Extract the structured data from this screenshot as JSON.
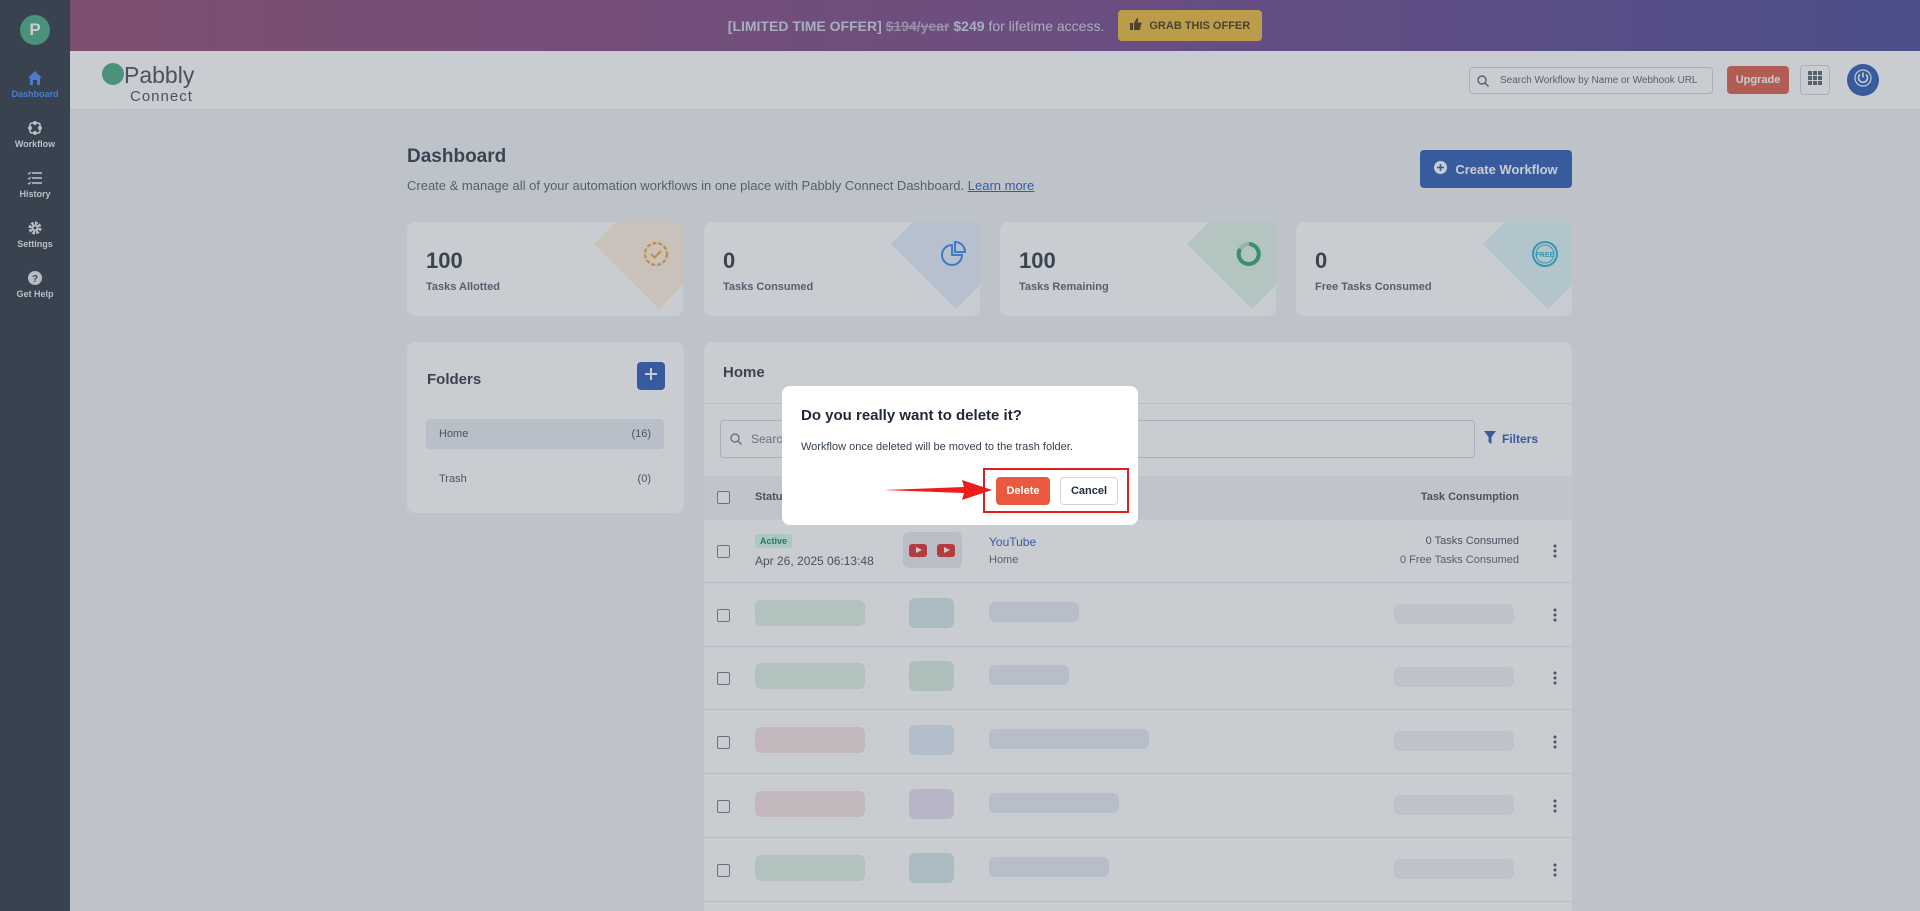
{
  "promo": {
    "prefix": "[LIMITED TIME OFFER]",
    "old_price": "$194/year",
    "new_price": "$249",
    "suffix": "for lifetime access.",
    "button": "GRAB THIS OFFER"
  },
  "sidebar": {
    "items": [
      {
        "label": "Dashboard",
        "icon": "home-icon"
      },
      {
        "label": "Workflow",
        "icon": "workflow-icon"
      },
      {
        "label": "History",
        "icon": "history-icon"
      },
      {
        "label": "Settings",
        "icon": "gear-icon"
      },
      {
        "label": "Get Help",
        "icon": "help-icon"
      }
    ]
  },
  "header": {
    "brand_name": "Pabbly",
    "brand_sub": "Connect",
    "search_placeholder": "Search Workflow by Name or Webhook URL",
    "upgrade": "Upgrade"
  },
  "page": {
    "title": "Dashboard",
    "subtitle": "Create & manage all of your automation workflows in one place with Pabbly Connect Dashboard.",
    "learn_more": "Learn more",
    "create_button": "Create Workflow"
  },
  "stats": [
    {
      "value": "100",
      "label": "Tasks Allotted",
      "icon": "badge-check-icon",
      "color": "#f0a030"
    },
    {
      "value": "0",
      "label": "Tasks Consumed",
      "icon": "pie-chart-icon",
      "color": "#2b7de9"
    },
    {
      "value": "100",
      "label": "Tasks Remaining",
      "icon": "progress-ring-icon",
      "color": "#22a35a"
    },
    {
      "value": "0",
      "label": "Free Tasks Consumed",
      "icon": "free-badge-icon",
      "color": "#1fa9c9"
    }
  ],
  "folders": {
    "title": "Folders",
    "items": [
      {
        "name": "Home",
        "count": "(16)"
      },
      {
        "name": "Trash",
        "count": "(0)"
      }
    ]
  },
  "panel": {
    "title": "Home",
    "search_placeholder": "Search",
    "filters": "Filters",
    "columns": {
      "status": "Status",
      "task": "Task Consumption"
    },
    "rows": [
      {
        "status": "Active",
        "date": "Apr 26, 2025 06:13:48",
        "name": "YouTube",
        "folder": "Home",
        "tasks": "0 Tasks Consumed",
        "free_tasks": "0 Free Tasks Consumed"
      }
    ]
  },
  "modal": {
    "title": "Do you really want to delete it?",
    "text": "Workflow once deleted will be moved to the trash folder.",
    "delete": "Delete",
    "cancel": "Cancel"
  },
  "colors": {
    "primary": "#1d4fae",
    "danger": "#e8593f",
    "sidebar": "#1e2a36",
    "highlight": "#e11d1d"
  }
}
